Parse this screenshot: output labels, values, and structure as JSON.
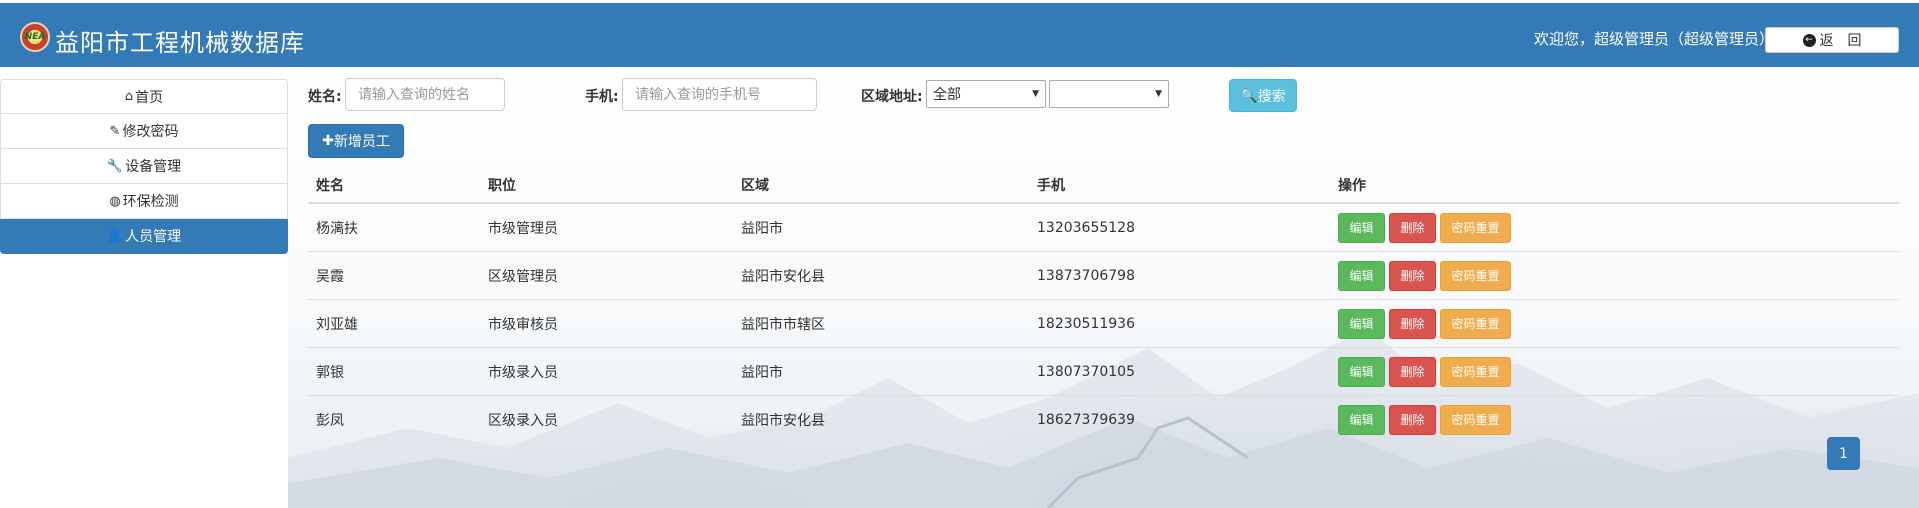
{
  "header": {
    "logo_text": "NEA",
    "title": "益阳市工程机械数据库",
    "welcome": "欢迎您，超级管理员（超级管理员）",
    "back_label": "返　回"
  },
  "sidebar": {
    "items": [
      {
        "label": "首页",
        "icon": "home-icon",
        "glyph": "⌂",
        "active": false
      },
      {
        "label": "修改密码",
        "icon": "pencil-icon",
        "glyph": "✎",
        "active": false
      },
      {
        "label": "设备管理",
        "icon": "wrench-icon",
        "glyph": "🔧",
        "active": false
      },
      {
        "label": "环保检测",
        "icon": "globe-icon",
        "glyph": "◍",
        "active": false
      },
      {
        "label": "人员管理",
        "icon": "user-icon",
        "glyph": "👤",
        "active": true
      }
    ]
  },
  "search": {
    "name_label": "姓名:",
    "name_placeholder": "请输入查询的姓名",
    "phone_label": "手机:",
    "phone_placeholder": "请输入查询的手机号",
    "region_label": "区域地址:",
    "region_value": "全部",
    "subregion_value": "",
    "search_label": "搜索",
    "add_label": "新增员工"
  },
  "table": {
    "headers": [
      "姓名",
      "职位",
      "区域",
      "手机",
      "操作"
    ],
    "rows": [
      {
        "name": "杨漓扶",
        "position": "市级管理员",
        "region": "益阳市",
        "phone": "13203655128"
      },
      {
        "name": "吴霞",
        "position": "区级管理员",
        "region": "益阳市安化县",
        "phone": "13873706798"
      },
      {
        "name": "刘亚雄",
        "position": "市级审核员",
        "region": "益阳市市辖区",
        "phone": "18230511936"
      },
      {
        "name": "郭银",
        "position": "市级录入员",
        "region": "益阳市",
        "phone": "13807370105"
      },
      {
        "name": "彭凤",
        "position": "区级录入员",
        "region": "益阳市安化县",
        "phone": "18627379639"
      }
    ],
    "actions": {
      "edit": "编辑",
      "delete": "删除",
      "reset": "密码重置"
    }
  },
  "pagination": {
    "current_page": "1"
  },
  "colors": {
    "primary": "#337ab7",
    "info": "#5bc0de",
    "success": "#5cb85c",
    "danger": "#d9534f",
    "warning": "#f0ad4e"
  }
}
